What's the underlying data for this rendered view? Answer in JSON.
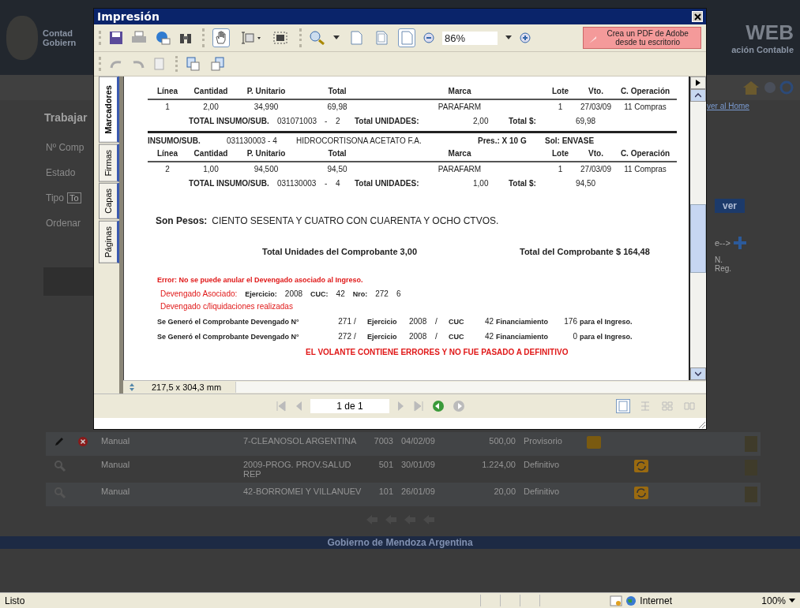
{
  "page": {
    "header": {
      "org_lines": [
        "Contad",
        "Gobiern"
      ],
      "brand": "WEB",
      "subtitle": "ación Contable"
    },
    "home_link": "ver al Home",
    "form": {
      "title": "Trabajar",
      "labels": [
        "Nº Comp",
        "Estado",
        "Tipo",
        "Ordenar"
      ],
      "type_value": "To"
    },
    "search_button": "ver",
    "next_link": "e-->",
    "column_header": "N. Reg.",
    "rows": [
      {
        "editable": true,
        "origin": "Manual",
        "name": "7-CLEANOSOL ARGENTINA",
        "number": "7003",
        "date": "04/02/09",
        "amount": "500,00",
        "status": "Provisorio"
      },
      {
        "editable": false,
        "origin": "Manual",
        "name": "2009-PROG. PROV.SALUD REP",
        "number": "501",
        "date": "30/01/09",
        "amount": "1.224,00",
        "status": "Definitivo"
      },
      {
        "editable": false,
        "origin": "Manual",
        "name": "42-BORROMEI Y VILLANUEV",
        "number": "101",
        "date": "26/01/09",
        "amount": "20,00",
        "status": "Definitivo"
      }
    ],
    "footer": "Gobierno de Mendoza Argentina"
  },
  "dialog": {
    "title": "Impresión",
    "tools": [
      {
        "kind": "hand",
        "selected": true
      },
      {
        "kind": "text",
        "selected": false
      },
      {
        "kind": "snapshot",
        "selected": false
      }
    ],
    "page_views": [
      {
        "kind": "actual",
        "selected": false
      },
      {
        "kind": "fit-page",
        "selected": false
      },
      {
        "kind": "fit-width",
        "selected": true
      }
    ],
    "zoom": "86%",
    "adobe_button": "Crea un PDF de Adobe desde tu escritorio",
    "side_tabs": [
      {
        "label": "Marcadores",
        "selected": true
      },
      {
        "label": "Firmas",
        "selected": false
      },
      {
        "label": "Capas",
        "selected": false
      },
      {
        "label": "Páginas",
        "selected": false
      }
    ],
    "document": {
      "items": [
        {
          "kind": "columns",
          "cells": [
            "Línea",
            "Cantidad",
            "P. Unitario",
            "Total",
            "Marca",
            "Lote",
            "Vto.",
            "C. Operación"
          ]
        },
        {
          "kind": "line",
          "cells": [
            "1",
            "2,00",
            "34,990",
            "69,98",
            "PARAFARM",
            "1",
            "27/03/09",
            "11 Compras"
          ]
        },
        {
          "kind": "total",
          "cells": [
            "TOTAL INSUMO/SUB.",
            "031071003",
            "-",
            "2",
            "Total UNIDADES:",
            "2,00",
            "Total $:",
            "69,98"
          ]
        },
        {
          "kind": "product",
          "cells": [
            "INSUMO/SUB.",
            "031130003 - 4",
            "HIDROCORTISONA ACETATO F.A.",
            "Pres.: X 10 G",
            "Sol: ENVASE"
          ]
        },
        {
          "kind": "columns",
          "cells": [
            "Línea",
            "Cantidad",
            "P. Unitario",
            "Total",
            "Marca",
            "Lote",
            "Vto.",
            "C. Operación"
          ]
        },
        {
          "kind": "line",
          "cells": [
            "2",
            "1,00",
            "94,500",
            "94,50",
            "PARAFARM",
            "1",
            "27/03/09",
            "11 Compras"
          ]
        },
        {
          "kind": "total",
          "cells": [
            "TOTAL INSUMO/SUB.",
            "031130003",
            "-",
            "4",
            "Total UNIDADES:",
            "1,00",
            "Total $:",
            "94,50"
          ]
        }
      ],
      "in_words": {
        "label": "Son Pesos:",
        "text": "CIENTO SESENTA Y CUATRO CON CUARENTA Y OCHO CTVOS."
      },
      "total_units": "Total Unidades del Comprobante 3,00",
      "total_amount": "Total del Comprobante $ 164,48",
      "error": "Error: No se puede anular el Devengado asociado al Ingreso.",
      "associated": {
        "label": "Devengado Asociado:",
        "fields": [
          "Ejercicio:",
          "2008",
          "CUC:",
          "42",
          "Nro:",
          "272",
          "6"
        ]
      },
      "note": "Devengado c/liquidaciones realizadas",
      "generated": [
        [
          "Se Generó el Comprobante Devengado N°",
          "271",
          "/",
          "Ejercicio",
          "2008",
          "/",
          "CUC",
          "42",
          "Financiamiento",
          "176",
          "para el Ingreso."
        ],
        [
          "Se Generó el Comprobante Devengado N°",
          "272",
          "/",
          "Ejercicio",
          "2008",
          "/",
          "CUC",
          "42",
          "Financiamiento",
          "0",
          "para el Ingreso."
        ]
      ],
      "verdict": "EL VOLANTE CONTIENE ERRORES Y NO FUE PASADO A  DEFINITIVO"
    },
    "page_size": "217,5 x 304,3 mm",
    "page_field": "1 de 1",
    "layouts": [
      {
        "kind": "single",
        "selected": true
      },
      {
        "kind": "continuous",
        "selected": false
      },
      {
        "kind": "facing",
        "selected": false
      },
      {
        "kind": "cover",
        "selected": false
      }
    ]
  },
  "status_bar": {
    "text": "Listo",
    "zone": "Internet",
    "zoom": "100%"
  }
}
